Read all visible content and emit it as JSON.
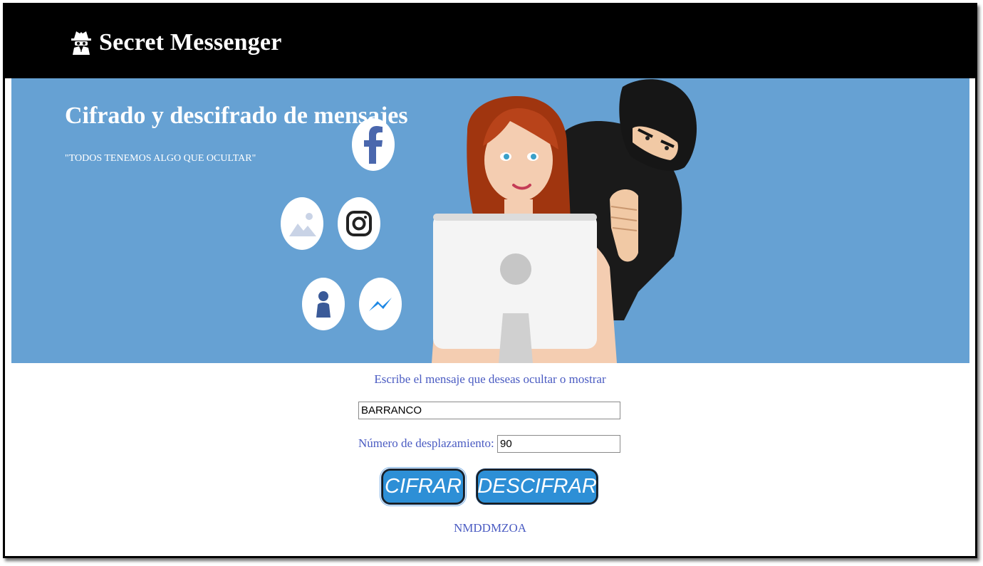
{
  "navbar": {
    "brand": "Secret Messenger",
    "brand_icon": "spy-icon"
  },
  "hero": {
    "title": "Cifrado y descifrado de mensajes",
    "quote": "\"TODOS TENEMOS ALGO QUE OCULTAR\"",
    "background": "#66a1d3",
    "icons": [
      "facebook-icon",
      "image-icon",
      "instagram-icon",
      "user-icon",
      "messenger-icon"
    ]
  },
  "form": {
    "prompt": "Escribe el mensaje que deseas ocultar o mostrar",
    "message_value": "BARRANCO",
    "shift_label": "Número de desplazamiento:",
    "shift_value": "90",
    "encrypt_label": "CIFRAR",
    "decrypt_label": "DESCIFRAR",
    "result": "NMDDMZOA",
    "accent": "#2d8fd6",
    "text_color": "#4a5bc2"
  }
}
